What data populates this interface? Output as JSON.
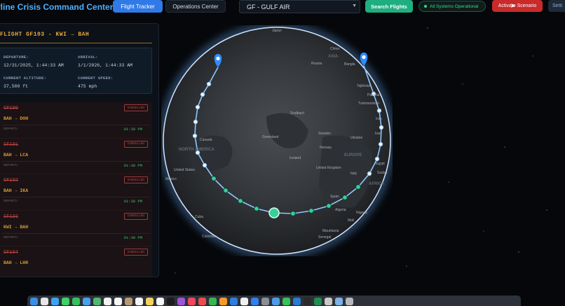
{
  "header": {
    "title": "rline Crisis Command Center",
    "tabs": [
      {
        "label": "Flight Tracker",
        "active": true
      },
      {
        "label": "Operations Center",
        "active": false
      }
    ],
    "airline_select": {
      "value": "GF - GULF AIR"
    },
    "search_button": "Search Flights",
    "status": "All Systems Operational",
    "scenario_button": "Activate Scenario",
    "settings_button": "Setti"
  },
  "flight_panel": {
    "title": "FLIGHT GF103 - KWI → BAH",
    "departure_label": "DEPARTURE:",
    "departure_value": "12/31/2025, 1:44:33 AM",
    "arrival_label": "ARRIVAL:",
    "arrival_value": "1/1/2026, 1:44:33 AM",
    "altitude_label": "CURRENT ALTITUDE:",
    "altitude_value": "37,500 ft",
    "speed_label": "CURRENT SPEED:",
    "speed_value": "475 mph"
  },
  "flights": [
    {
      "number": "GF100",
      "status": "CANCELLED",
      "route": "BAH → DOH",
      "dep_label": "DEPARTS:",
      "time": "01:38 PM"
    },
    {
      "number": "GF101",
      "status": "CANCELLED",
      "route": "BAH → LCA",
      "dep_label": "DEPARTS:",
      "time": "01:38 PM"
    },
    {
      "number": "GF102",
      "status": "CANCELLED",
      "route": "BAH → IKA",
      "dep_label": "DEPARTS:",
      "time": "01:38 PM"
    },
    {
      "number": "GF103",
      "status": "CANCELLED",
      "route": "KWI → BAH",
      "dep_label": "DEPARTS:",
      "time": "01:38 PM"
    },
    {
      "number": "GF104",
      "status": "CANCELLED",
      "route": "BAH → LHR",
      "dep_label": "",
      "time": ""
    }
  ],
  "map": {
    "labels": [
      {
        "text": "Japan",
        "kind": "place"
      },
      {
        "text": "China",
        "kind": "place"
      },
      {
        "text": "Russia",
        "kind": "place"
      },
      {
        "text": "ASIA",
        "kind": "country"
      },
      {
        "text": "Bangla",
        "kind": "place"
      },
      {
        "text": "Tajikistan",
        "kind": "place"
      },
      {
        "text": "Pakistan",
        "kind": "place"
      },
      {
        "text": "Turkmenistan",
        "kind": "place"
      },
      {
        "text": "Iran",
        "kind": "place"
      },
      {
        "text": "Svalbard",
        "kind": "place"
      },
      {
        "text": "Greenland",
        "kind": "place"
      },
      {
        "text": "Sweden",
        "kind": "place"
      },
      {
        "text": "Norway",
        "kind": "place"
      },
      {
        "text": "Ukraine",
        "kind": "place"
      },
      {
        "text": "Iraq",
        "kind": "place"
      },
      {
        "text": "Egypt",
        "kind": "place"
      },
      {
        "text": "Sudan",
        "kind": "place"
      },
      {
        "text": "EUROPE",
        "kind": "country"
      },
      {
        "text": "Iceland",
        "kind": "place"
      },
      {
        "text": "United Kingdom",
        "kind": "place"
      },
      {
        "text": "Italy",
        "kind": "place"
      },
      {
        "text": "AFRICA",
        "kind": "country"
      },
      {
        "text": "Spain",
        "kind": "place"
      },
      {
        "text": "Algeria",
        "kind": "place"
      },
      {
        "text": "Nigeria",
        "kind": "place"
      },
      {
        "text": "Mali",
        "kind": "place"
      },
      {
        "text": "Mauritania",
        "kind": "place"
      },
      {
        "text": "Senegal",
        "kind": "place"
      },
      {
        "text": "NORTH AMERICA",
        "kind": "country"
      },
      {
        "text": "Canada",
        "kind": "place"
      },
      {
        "text": "United States",
        "kind": "place"
      },
      {
        "text": "Mexico",
        "kind": "place"
      },
      {
        "text": "Cuba",
        "kind": "place"
      },
      {
        "text": "Colombia",
        "kind": "place"
      }
    ]
  },
  "colors": {
    "accent": "#2f7ae6",
    "title": "#4fb0ff",
    "panel_title": "#e9a83b",
    "cancelled": "#c44848",
    "route_line": "#8fc8ff",
    "route_point": "#34d19a",
    "pin": "#2f8cff"
  },
  "dock": {
    "icons": [
      "finder-icon",
      "launchpad-icon",
      "safari-icon",
      "messages-icon",
      "facetime-icon",
      "mail-icon",
      "maps-icon",
      "photos-icon",
      "calendar-icon",
      "contacts-icon",
      "reminders-icon",
      "notes-icon",
      "freeform-icon",
      "appletv-icon",
      "podcasts-icon",
      "music-icon",
      "news-icon",
      "numbers-icon",
      "pages-icon",
      "keynote-icon",
      "chrome-icon",
      "appstore-icon",
      "settings-icon",
      "preview-icon",
      "whatsapp-icon",
      "vscode-icon",
      "terminal-icon",
      "excel-icon",
      "help-icon",
      "downloads-icon",
      "trash-icon"
    ]
  }
}
